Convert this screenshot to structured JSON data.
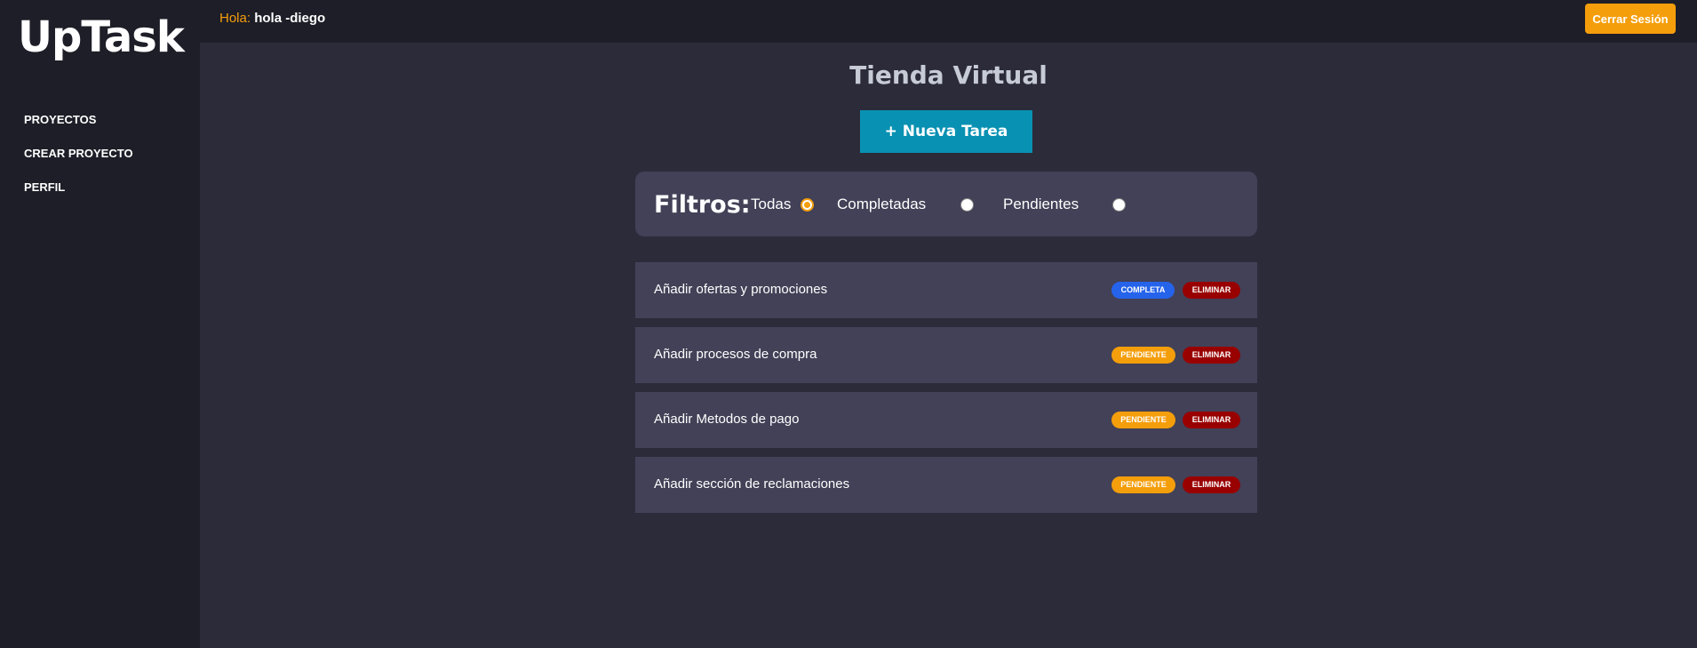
{
  "sidebar": {
    "logo": "UpTask",
    "items": [
      {
        "label": "PROYECTOS"
      },
      {
        "label": "CREAR PROYECTO"
      },
      {
        "label": "PERFIL"
      }
    ]
  },
  "header": {
    "greeting_label": "Hola:",
    "username": "hola -diego",
    "logout_label": "Cerrar Sesión"
  },
  "main": {
    "title": "Tienda Virtual",
    "new_task_label": "+ Nueva Tarea",
    "filters": {
      "label": "Filtros:",
      "options": [
        {
          "label": "Todas",
          "checked": true
        },
        {
          "label": "Completadas",
          "checked": false
        },
        {
          "label": "Pendientes",
          "checked": false
        }
      ]
    },
    "tasks": [
      {
        "name": "Añadir ofertas y promociones",
        "status": "COMPLETA",
        "delete_label": "ELIMINAR"
      },
      {
        "name": "Añadir procesos de compra",
        "status": "PENDIENTE",
        "delete_label": "ELIMINAR"
      },
      {
        "name": "Añadir Metodos de pago",
        "status": "PENDIENTE",
        "delete_label": "ELIMINAR"
      },
      {
        "name": "Añadir sección de reclamaciones",
        "status": "PENDIENTE",
        "delete_label": "ELIMINAR"
      }
    ]
  },
  "colors": {
    "accent": "#f59e0b",
    "primary_button": "#0891b2",
    "complete_badge": "#2563eb",
    "delete_badge": "#990000",
    "panel": "#424157"
  }
}
